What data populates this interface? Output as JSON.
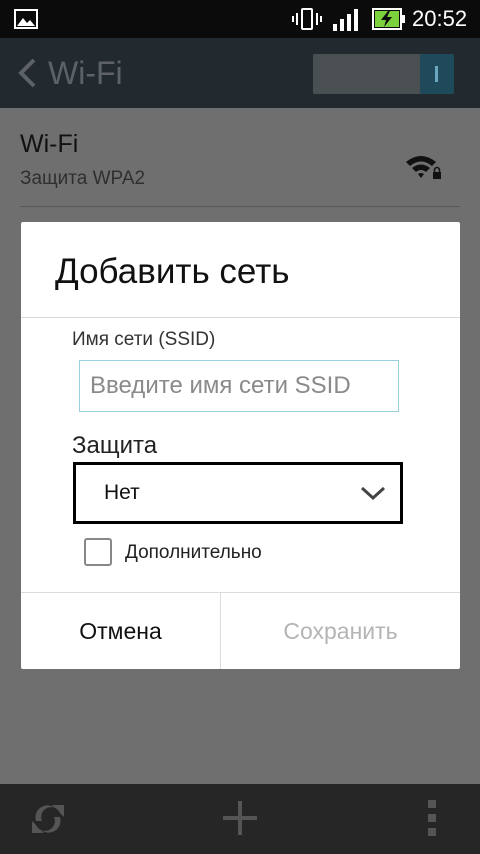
{
  "status_bar": {
    "time": "20:52",
    "icons": [
      "gallery-icon",
      "vibrate-icon",
      "signal-icon",
      "battery-charging-icon"
    ]
  },
  "action_bar": {
    "back_icon": "chevron-left-icon",
    "title": "Wi-Fi",
    "toggle_state": "on"
  },
  "network_list": [
    {
      "name": "Wi-Fi",
      "security": "Защита WPA2",
      "icon": "wifi-lock-icon"
    }
  ],
  "dialog": {
    "title": "Добавить сеть",
    "ssid_label": "Имя сети (SSID)",
    "ssid_placeholder": "Введите имя сети SSID",
    "ssid_value": "",
    "security_label": "Защита",
    "security_selected": "Нет",
    "advanced_label": "Дополнительно",
    "advanced_checked": false,
    "cancel_label": "Отмена",
    "save_label": "Сохранить"
  },
  "bottom_bar": {
    "icons": [
      "refresh-icon",
      "add-icon",
      "more-vert-icon"
    ]
  },
  "colors": {
    "dialog_bg": "#ffffff",
    "action_bar_bg": "#222a30",
    "input_border": "#9ad0dd",
    "disabled_text": "#b4b4b4"
  }
}
